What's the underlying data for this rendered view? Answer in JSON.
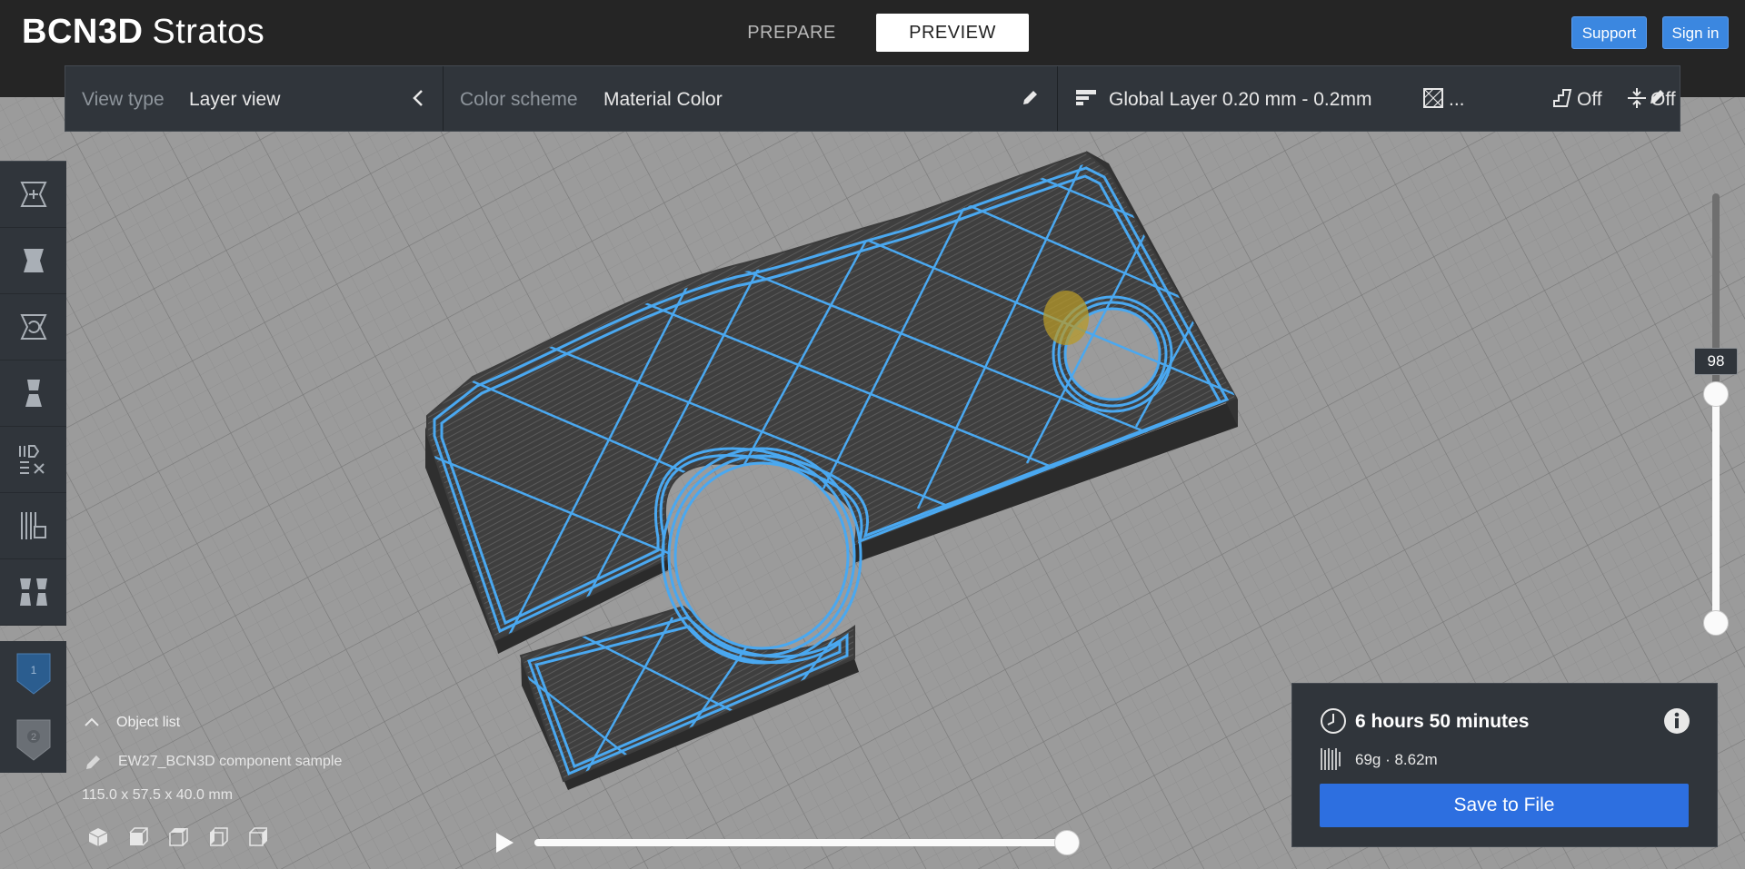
{
  "app": {
    "brand_bold": "BCN3D",
    "brand_light": "Stratos",
    "stages": {
      "prepare": "PREPARE",
      "preview": "PREVIEW"
    },
    "active_stage": "preview",
    "support_label": "Support",
    "signin_label": "Sign in"
  },
  "view_options": {
    "view_type_label": "View type",
    "view_type_value": "Layer view",
    "color_scheme_label": "Color scheme",
    "color_scheme_value": "Material Color",
    "global_layer": "Global Layer 0.20 mm - 0.2mm",
    "infill_value": "...",
    "support_value": "Off",
    "adhesion_value": "Off"
  },
  "left_tools": [
    "translate-tool",
    "scale-tool",
    "rotate-tool",
    "mirror-tool",
    "per-model-settings-tool",
    "support-blocker-tool",
    "print-mode-tool"
  ],
  "extruders": [
    {
      "number": "1",
      "color": "#2b5d8f",
      "active": true
    },
    {
      "number": "2",
      "color": "#6a6f75",
      "active": false
    }
  ],
  "object_list": {
    "header": "Object list",
    "object_name": "EW27_BCN3D component sample",
    "dimensions": "115.0 x 57.5 x 40.0 mm"
  },
  "layer_slider": {
    "current_layer": "98",
    "max_layer": 200,
    "top_fraction": 0.49
  },
  "timeline": {
    "progress": 1.0
  },
  "print_info": {
    "time": "6 hours 50 minutes",
    "material": "69g · 8.62m",
    "save_label": "Save to File"
  },
  "colors": {
    "accent_blue": "#2d6fe0",
    "button_blue": "#3b87e0",
    "panel": "#30353b",
    "topbar": "#252525",
    "wall_blue": "#4aa8f0",
    "model_dark": "#3c3c3c",
    "build_plate": "#9b9b9b"
  }
}
